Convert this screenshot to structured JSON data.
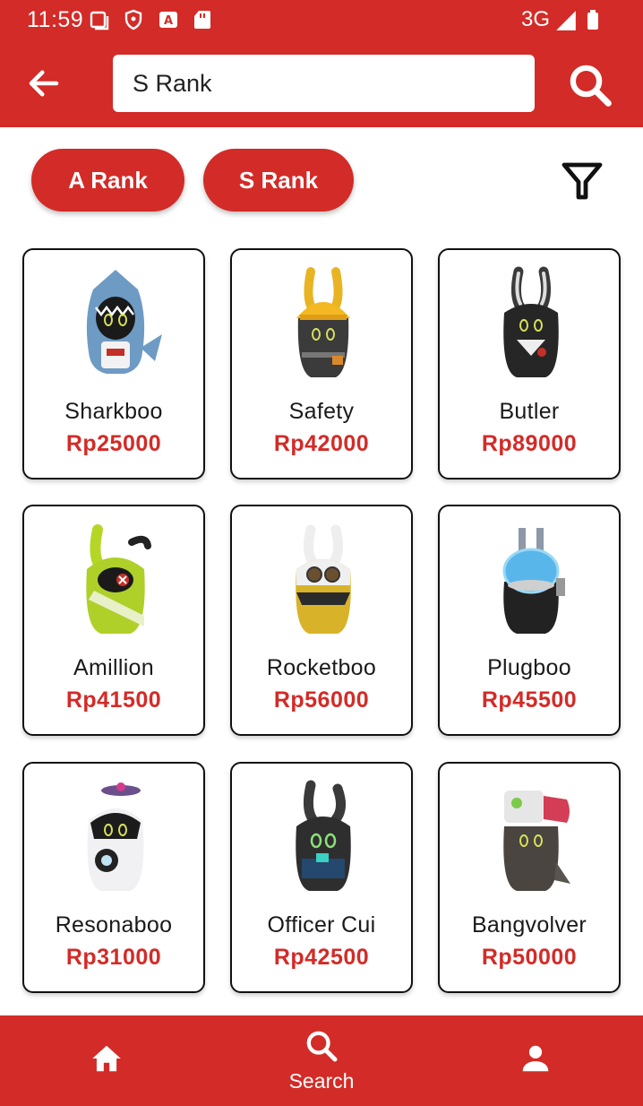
{
  "status_bar": {
    "time": "11:59",
    "network": "3G"
  },
  "search": {
    "value": "S Rank"
  },
  "chips": [
    {
      "label": "A Rank"
    },
    {
      "label": "S Rank"
    }
  ],
  "colors": {
    "accent": "#d32b27",
    "price": "#d32b27",
    "card_border": "#111111"
  },
  "items": [
    {
      "name": "Sharkboo",
      "price": "Rp25000",
      "icon": "shark-bangboo-icon"
    },
    {
      "name": "Safety",
      "price": "Rp42000",
      "icon": "hardhat-bangboo-icon"
    },
    {
      "name": "Butler",
      "price": "Rp89000",
      "icon": "butler-bangboo-icon"
    },
    {
      "name": "Amillion",
      "price": "Rp41500",
      "icon": "green-bangboo-icon"
    },
    {
      "name": "Rocketboo",
      "price": "Rp56000",
      "icon": "pilot-bangboo-icon"
    },
    {
      "name": "Plugboo",
      "price": "Rp45500",
      "icon": "plug-bangboo-icon"
    },
    {
      "name": "Resonaboo",
      "price": "Rp31000",
      "icon": "speaker-bangboo-icon"
    },
    {
      "name": "Officer Cui",
      "price": "Rp42500",
      "icon": "officer-bangboo-icon"
    },
    {
      "name": "Bangvolver",
      "price": "Rp50000",
      "icon": "gun-bangboo-icon"
    }
  ],
  "bottom_nav": {
    "home_icon": "home-icon",
    "search_label": "Search",
    "profile_icon": "person-icon"
  }
}
